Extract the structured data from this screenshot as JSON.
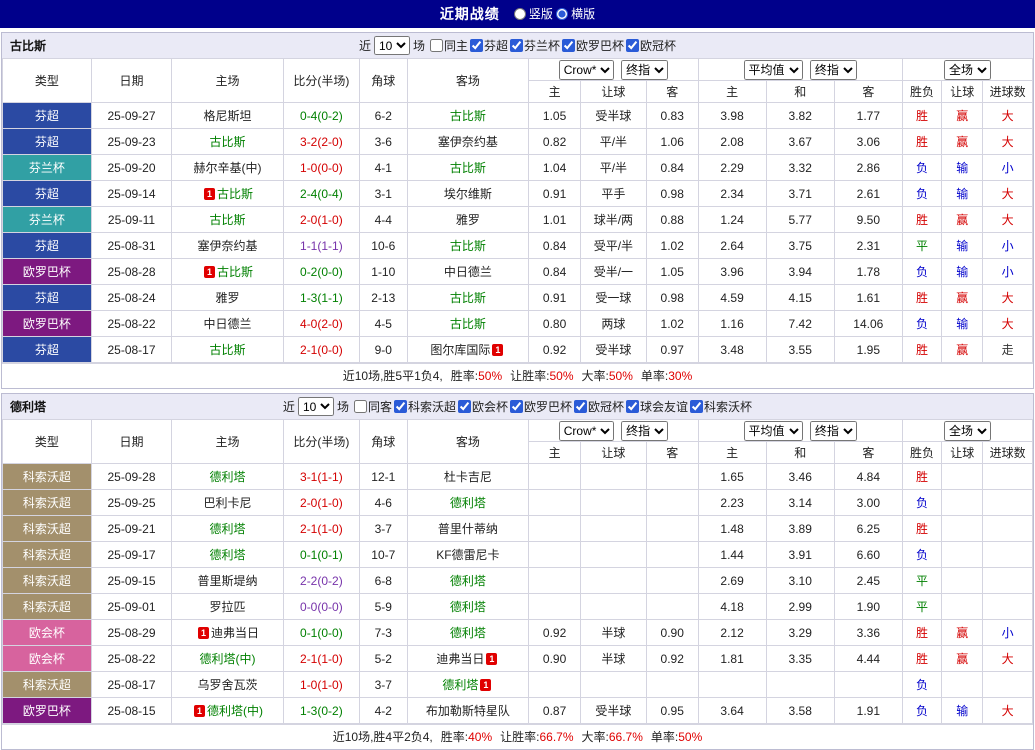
{
  "top_bar": {
    "title": "近期战绩",
    "radios": [
      {
        "label": "竖版",
        "checked": false
      },
      {
        "label": "横版",
        "checked": true
      }
    ]
  },
  "palette": {
    "red": "#d40000",
    "green": "#008000",
    "blue": "#0000cc",
    "purple": "#7733aa",
    "dark": "#333333"
  },
  "status_colors": {
    "胜": "red",
    "平": "green",
    "负": "blue",
    "赢": "red",
    "输": "blue",
    "大": "red",
    "小": "blue",
    "走": "dark"
  },
  "league_colors": {
    "芬超": "#2b4aa3",
    "芬兰杯": "#31a0a4",
    "欧罗巴杯": "#7d1980",
    "科索沃超": "#a3906c",
    "欧会杯": "#d7639e"
  },
  "header_labels": {
    "type": "类型",
    "date": "日期",
    "home": "主场",
    "score": "比分(半场)",
    "corner": "角球",
    "away": "客场",
    "odds_sub": [
      "主",
      "让球",
      "客"
    ],
    "avg_sub": [
      "主",
      "和",
      "客"
    ],
    "result_sub": [
      "胜负",
      "让球",
      "进球数"
    ],
    "selects": {
      "crow": "Crow*",
      "final": "终指",
      "avg": "平均值",
      "full": "全场"
    }
  },
  "sections": [
    {
      "team": "古比斯",
      "filter": {
        "prefix": "近",
        "count": "10",
        "suffix": "场",
        "same_label": "同主",
        "same_checked": false,
        "leagues": [
          {
            "label": "芬超",
            "checked": true
          },
          {
            "label": "芬兰杯",
            "checked": true
          },
          {
            "label": "欧罗巴杯",
            "checked": true
          },
          {
            "label": "欧冠杯",
            "checked": true
          }
        ]
      },
      "rows": [
        {
          "type": "芬超",
          "date": "25-09-27",
          "home": "格尼斯坦",
          "score": "0-4(0-2)",
          "score_color": "green",
          "corner": "6-2",
          "away": "古比斯",
          "away_green": true,
          "odds": [
            "1.05",
            "受半球",
            "0.83"
          ],
          "avg": [
            "3.98",
            "3.82",
            "1.77"
          ],
          "res": [
            "胜",
            "赢",
            "大"
          ]
        },
        {
          "type": "芬超",
          "date": "25-09-23",
          "home": "古比斯",
          "home_green": true,
          "score": "3-2(2-0)",
          "score_color": "red",
          "corner": "3-6",
          "away": "塞伊奈约基",
          "odds": [
            "0.82",
            "平/半",
            "1.06"
          ],
          "avg": [
            "2.08",
            "3.67",
            "3.06"
          ],
          "res": [
            "胜",
            "赢",
            "大"
          ]
        },
        {
          "type": "芬兰杯",
          "date": "25-09-20",
          "home": "赫尔辛基(中)",
          "score": "1-0(0-0)",
          "score_color": "red",
          "corner": "4-1",
          "away": "古比斯",
          "away_green": true,
          "odds": [
            "1.04",
            "平/半",
            "0.84"
          ],
          "avg": [
            "2.29",
            "3.32",
            "2.86"
          ],
          "res": [
            "负",
            "输",
            "小"
          ]
        },
        {
          "type": "芬超",
          "date": "25-09-14",
          "home": "古比斯",
          "home_green": true,
          "home_card": "prefix",
          "score": "2-4(0-4)",
          "score_color": "green",
          "corner": "3-1",
          "away": "埃尔维斯",
          "odds": [
            "0.91",
            "平手",
            "0.98"
          ],
          "avg": [
            "2.34",
            "3.71",
            "2.61"
          ],
          "res": [
            "负",
            "输",
            "大"
          ]
        },
        {
          "type": "芬兰杯",
          "date": "25-09-11",
          "home": "古比斯",
          "home_green": true,
          "score": "2-0(1-0)",
          "score_color": "red",
          "corner": "4-4",
          "away": "雅罗",
          "odds": [
            "1.01",
            "球半/两",
            "0.88"
          ],
          "avg": [
            "1.24",
            "5.77",
            "9.50"
          ],
          "res": [
            "胜",
            "赢",
            "大"
          ]
        },
        {
          "type": "芬超",
          "date": "25-08-31",
          "home": "塞伊奈约基",
          "score": "1-1(1-1)",
          "score_color": "purple",
          "corner": "10-6",
          "away": "古比斯",
          "away_green": true,
          "odds": [
            "0.84",
            "受平/半",
            "1.02"
          ],
          "avg": [
            "2.64",
            "3.75",
            "2.31"
          ],
          "res": [
            "平",
            "输",
            "小"
          ]
        },
        {
          "type": "欧罗巴杯",
          "date": "25-08-28",
          "home": "古比斯",
          "home_green": true,
          "home_card": "prefix",
          "score": "0-2(0-0)",
          "score_color": "green",
          "corner": "1-10",
          "away": "中日德兰",
          "odds": [
            "0.84",
            "受半/一",
            "1.05"
          ],
          "avg": [
            "3.96",
            "3.94",
            "1.78"
          ],
          "res": [
            "负",
            "输",
            "小"
          ]
        },
        {
          "type": "芬超",
          "date": "25-08-24",
          "home": "雅罗",
          "score": "1-3(1-1)",
          "score_color": "green",
          "corner": "2-13",
          "away": "古比斯",
          "away_green": true,
          "odds": [
            "0.91",
            "受一球",
            "0.98"
          ],
          "avg": [
            "4.59",
            "4.15",
            "1.61"
          ],
          "res": [
            "胜",
            "赢",
            "大"
          ]
        },
        {
          "type": "欧罗巴杯",
          "date": "25-08-22",
          "home": "中日德兰",
          "score": "4-0(2-0)",
          "score_color": "red",
          "corner": "4-5",
          "away": "古比斯",
          "away_green": true,
          "odds": [
            "0.80",
            "两球",
            "1.02"
          ],
          "avg": [
            "1.16",
            "7.42",
            "14.06"
          ],
          "res": [
            "负",
            "输",
            "大"
          ]
        },
        {
          "type": "芬超",
          "date": "25-08-17",
          "home": "古比斯",
          "home_green": true,
          "score": "2-1(0-0)",
          "score_color": "red",
          "corner": "9-0",
          "away": "图尔库国际",
          "away_card": "suffix",
          "odds": [
            "0.92",
            "受半球",
            "0.97"
          ],
          "avg": [
            "3.48",
            "3.55",
            "1.95"
          ],
          "res": [
            "胜",
            "赢",
            "走"
          ]
        }
      ],
      "summary": {
        "record": "近10场,胜5平1负4,",
        "stats": [
          {
            "label": "胜率:",
            "value": "50%"
          },
          {
            "label": "让胜率:",
            "value": "50%"
          },
          {
            "label": "大率:",
            "value": "50%"
          },
          {
            "label": "单率:",
            "value": "30%"
          }
        ]
      }
    },
    {
      "team": "德利塔",
      "filter": {
        "prefix": "近",
        "count": "10",
        "suffix": "场",
        "same_label": "同客",
        "same_checked": false,
        "leagues": [
          {
            "label": "科索沃超",
            "checked": true
          },
          {
            "label": "欧会杯",
            "checked": true
          },
          {
            "label": "欧罗巴杯",
            "checked": true
          },
          {
            "label": "欧冠杯",
            "checked": true
          },
          {
            "label": "球会友谊",
            "checked": true
          },
          {
            "label": "科索沃杯",
            "checked": true
          }
        ]
      },
      "rows": [
        {
          "type": "科索沃超",
          "date": "25-09-28",
          "home": "德利塔",
          "home_green": true,
          "score": "3-1(1-1)",
          "score_color": "red",
          "corner": "12-1",
          "away": "杜卡吉尼",
          "avg": [
            "1.65",
            "3.46",
            "4.84"
          ],
          "res": [
            "胜",
            "",
            ""
          ]
        },
        {
          "type": "科索沃超",
          "date": "25-09-25",
          "home": "巴利卡尼",
          "score": "2-0(1-0)",
          "score_color": "red",
          "corner": "4-6",
          "away": "德利塔",
          "away_green": true,
          "avg": [
            "2.23",
            "3.14",
            "3.00"
          ],
          "res": [
            "负",
            "",
            ""
          ]
        },
        {
          "type": "科索沃超",
          "date": "25-09-21",
          "home": "德利塔",
          "home_green": true,
          "score": "2-1(1-0)",
          "score_color": "red",
          "corner": "3-7",
          "away": "普里什蒂纳",
          "avg": [
            "1.48",
            "3.89",
            "6.25"
          ],
          "res": [
            "胜",
            "",
            ""
          ]
        },
        {
          "type": "科索沃超",
          "date": "25-09-17",
          "home": "德利塔",
          "home_green": true,
          "score": "0-1(0-1)",
          "score_color": "green",
          "corner": "10-7",
          "away": "KF德雷尼卡",
          "avg": [
            "1.44",
            "3.91",
            "6.60"
          ],
          "res": [
            "负",
            "",
            ""
          ]
        },
        {
          "type": "科索沃超",
          "date": "25-09-15",
          "home": "普里斯堤纳",
          "score": "2-2(0-2)",
          "score_color": "purple",
          "corner": "6-8",
          "away": "德利塔",
          "away_green": true,
          "avg": [
            "2.69",
            "3.10",
            "2.45"
          ],
          "res": [
            "平",
            "",
            ""
          ]
        },
        {
          "type": "科索沃超",
          "date": "25-09-01",
          "home": "罗拉匹",
          "score": "0-0(0-0)",
          "score_color": "purple",
          "corner": "5-9",
          "away": "德利塔",
          "away_green": true,
          "avg": [
            "4.18",
            "2.99",
            "1.90"
          ],
          "res": [
            "平",
            "",
            ""
          ]
        },
        {
          "type": "欧会杯",
          "date": "25-08-29",
          "home": "迪弗当日",
          "home_card": "prefix",
          "score": "0-1(0-0)",
          "score_color": "green",
          "corner": "7-3",
          "away": "德利塔",
          "away_green": true,
          "odds": [
            "0.92",
            "半球",
            "0.90"
          ],
          "avg": [
            "2.12",
            "3.29",
            "3.36"
          ],
          "res": [
            "胜",
            "赢",
            "小"
          ]
        },
        {
          "type": "欧会杯",
          "date": "25-08-22",
          "home": "德利塔(中)",
          "home_green": true,
          "score": "2-1(1-0)",
          "score_color": "red",
          "corner": "5-2",
          "away": "迪弗当日",
          "away_card": "suffix",
          "odds": [
            "0.90",
            "半球",
            "0.92"
          ],
          "avg": [
            "1.81",
            "3.35",
            "4.44"
          ],
          "res": [
            "胜",
            "赢",
            "大"
          ]
        },
        {
          "type": "科索沃超",
          "date": "25-08-17",
          "home": "乌罗舍瓦茨",
          "score": "1-0(1-0)",
          "score_color": "red",
          "corner": "3-7",
          "away": "德利塔",
          "away_green": true,
          "away_card": "suffix",
          "res": [
            "负",
            "",
            ""
          ]
        },
        {
          "type": "欧罗巴杯",
          "date": "25-08-15",
          "home": "德利塔(中)",
          "home_green": true,
          "home_card": "prefix",
          "score": "1-3(0-2)",
          "score_color": "green",
          "corner": "4-2",
          "away": "布加勒斯特星队",
          "odds": [
            "0.87",
            "受半球",
            "0.95"
          ],
          "avg": [
            "3.64",
            "3.58",
            "1.91"
          ],
          "res": [
            "负",
            "输",
            "大"
          ]
        }
      ],
      "summary": {
        "record": "近10场,胜4平2负4,",
        "stats": [
          {
            "label": "胜率:",
            "value": "40%"
          },
          {
            "label": "让胜率:",
            "value": "66.7%"
          },
          {
            "label": "大率:",
            "value": "66.7%"
          },
          {
            "label": "单率:",
            "value": "50%"
          }
        ]
      }
    }
  ]
}
